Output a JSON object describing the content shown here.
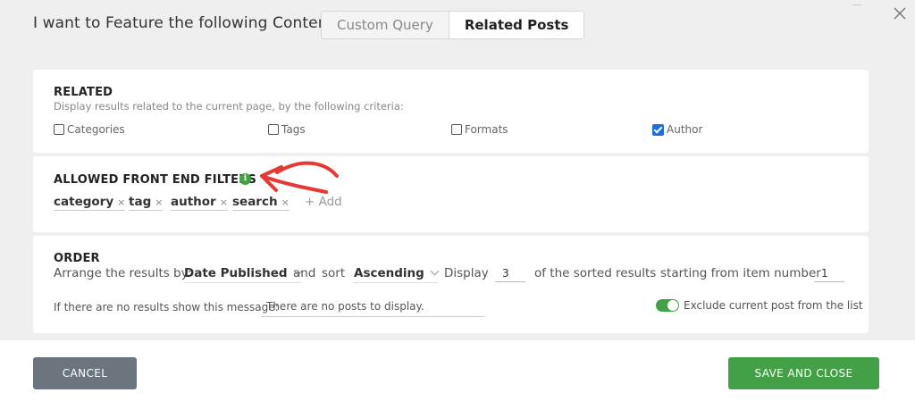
{
  "header": {
    "title": "I want to Feature the following Content",
    "tabs": [
      {
        "label": "Custom Query",
        "active": false
      },
      {
        "label": "Related Posts",
        "active": true
      }
    ]
  },
  "related": {
    "heading": "RELATED",
    "description": "Display results related to the current page, by the following criteria:",
    "criteria": [
      {
        "label": "Categories",
        "checked": false
      },
      {
        "label": "Tags",
        "checked": false
      },
      {
        "label": "Formats",
        "checked": false
      },
      {
        "label": "Author",
        "checked": true
      }
    ]
  },
  "filters": {
    "heading": "ALLOWED FRONT END FILTERS",
    "info_icon": "i",
    "chips": [
      "category",
      "tag",
      "author",
      "search"
    ],
    "remove_glyph": "×",
    "add_label": "+ Add"
  },
  "order": {
    "heading": "ORDER",
    "arrange_label": "Arrange the results by:",
    "arrange_value": "Date Published",
    "and_label": "and",
    "sort_label": "sort",
    "sort_value": "Ascending",
    "display_label": "Display",
    "display_count": "3",
    "sorted_label": "of the sorted results",
    "starting_label": "starting from item number",
    "start_number": "1",
    "no_results_label": "If there are no results show this message:",
    "no_results_message": "There are no posts to display.",
    "exclude_label": "Exclude current post from the list",
    "exclude_enabled": true
  },
  "footer": {
    "cancel_label": "CANCEL",
    "save_label": "SAVE AND CLOSE"
  },
  "colors": {
    "accent_green": "#43a047",
    "cancel_gray": "#6c747d",
    "checkbox_blue": "#1e6fd9",
    "annotation_red": "#e53935"
  }
}
